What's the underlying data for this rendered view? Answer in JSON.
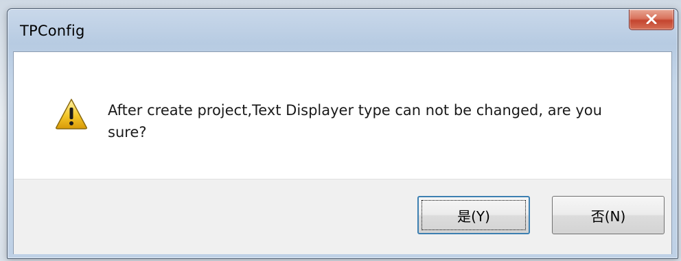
{
  "dialog": {
    "title": "TPConfig",
    "close_label": "X",
    "message": "After create project,Text Displayer type can not be changed, are you sure?",
    "icon": "warning-icon",
    "buttons": {
      "yes_label": "是(Y)",
      "no_label": "否(N)"
    }
  },
  "colors": {
    "accent": "#3c7fb1",
    "close_button": "#c4452f",
    "button_area": "#f0f0f0"
  }
}
